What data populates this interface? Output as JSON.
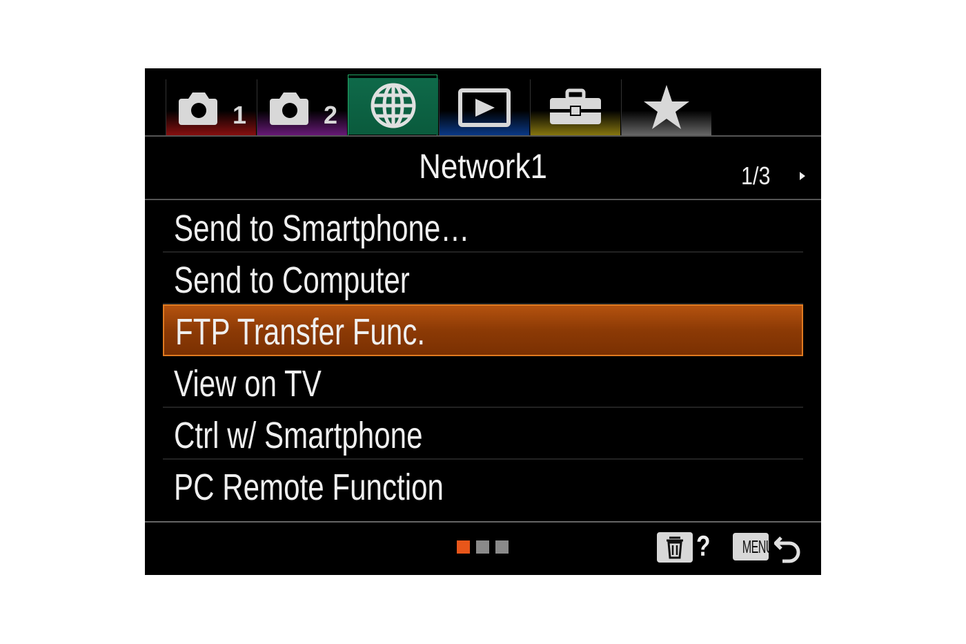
{
  "tabs": [
    {
      "icon": "camera-icon",
      "subscript": "1",
      "accent": "#8a1010",
      "selected": false
    },
    {
      "icon": "camera-icon",
      "subscript": "2",
      "accent": "#6a1a7a",
      "selected": false
    },
    {
      "icon": "globe-icon",
      "subscript": "",
      "accent": "#0f6a4a",
      "selected": true
    },
    {
      "icon": "play-icon",
      "subscript": "",
      "accent": "#0a3a8a",
      "selected": false
    },
    {
      "icon": "toolbox-icon",
      "subscript": "",
      "accent": "#8a7a10",
      "selected": false
    },
    {
      "icon": "star-icon",
      "subscript": "",
      "accent": "#6a6a6a",
      "selected": false
    }
  ],
  "header": {
    "title": "Network1",
    "page_indicator": "1/3"
  },
  "menu_items": [
    {
      "label": "Send to Smartphone…",
      "selected": false
    },
    {
      "label": "Send to Computer",
      "selected": false
    },
    {
      "label": "FTP Transfer Func.",
      "selected": true
    },
    {
      "label": "View on TV",
      "selected": false
    },
    {
      "label": "Ctrl w/ Smartphone",
      "selected": false
    },
    {
      "label": "PC Remote Function",
      "selected": false
    }
  ],
  "page_dots": {
    "count": 3,
    "active_index": 0,
    "active_color": "#e8561a",
    "inactive_color": "#8a8a8a"
  },
  "footer": {
    "help_label": "?",
    "menu_label": "MENU"
  },
  "colors": {
    "selection_fill": "#a8480c",
    "selection_border": "#e07a20",
    "text": "#efefef"
  }
}
